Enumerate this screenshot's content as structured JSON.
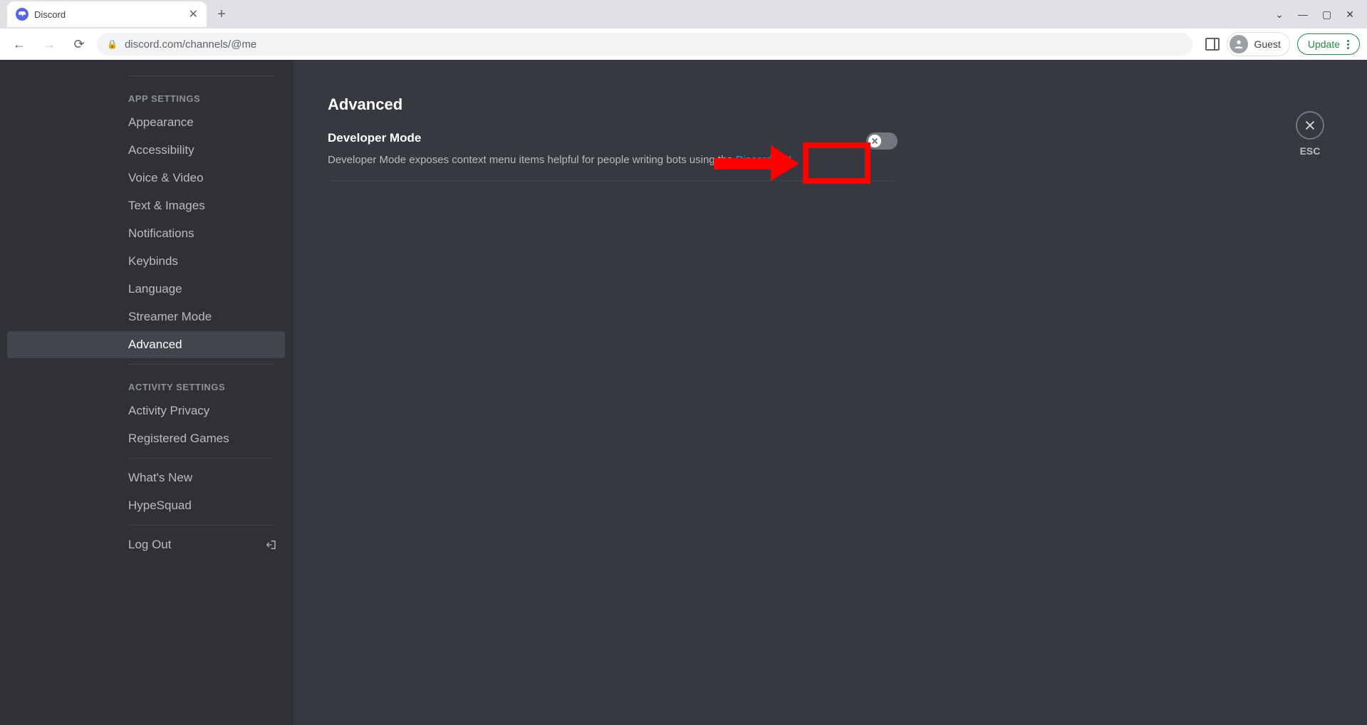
{
  "browser": {
    "tab_title": "Discord",
    "url": "discord.com/channels/@me",
    "profile_label": "Guest",
    "update_label": "Update"
  },
  "sidebar": {
    "app_settings_heading": "APP SETTINGS",
    "app_items": [
      "Appearance",
      "Accessibility",
      "Voice & Video",
      "Text & Images",
      "Notifications",
      "Keybinds",
      "Language",
      "Streamer Mode",
      "Advanced"
    ],
    "activity_settings_heading": "ACTIVITY SETTINGS",
    "activity_items": [
      "Activity Privacy",
      "Registered Games"
    ],
    "misc_items": [
      "What's New",
      "HypeSquad"
    ],
    "logout_label": "Log Out"
  },
  "content": {
    "title": "Advanced",
    "developer_mode_label": "Developer Mode",
    "developer_mode_desc_prefix": "Developer Mode exposes context menu items helpful for people writing bots using the ",
    "developer_mode_link": "Discord API",
    "developer_mode_desc_suffix": ".",
    "esc_label": "ESC"
  },
  "colors": {
    "highlight": "#ff0000",
    "link": "#00aff4"
  }
}
